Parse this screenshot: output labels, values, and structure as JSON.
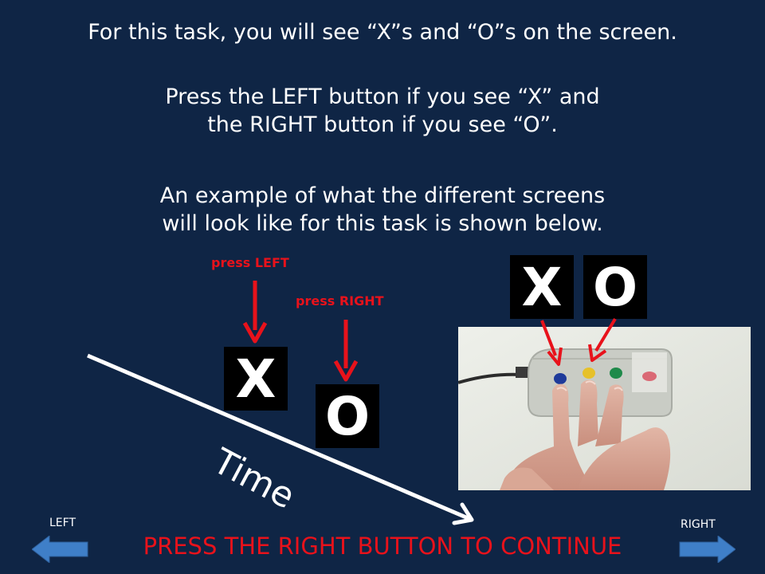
{
  "instructions": {
    "line1": "For this task, you will see “X”s and “O”s on the screen.",
    "line2a": "Press the LEFT button if you see “X” and",
    "line2b": "the RIGHT button if you see “O”.",
    "line3a": "An example of what the different screens",
    "line3b": "will look like for this task is shown below."
  },
  "diagram": {
    "press_left_label": "press LEFT",
    "press_right_label": "press RIGHT",
    "letter_x": "X",
    "letter_o": "O",
    "time_label": "Time"
  },
  "device_example": {
    "letter_x": "X",
    "letter_o": "O",
    "button_colors": [
      "#1e3a9a",
      "#e6c12a",
      "#1f8a4a",
      "#d84a5a"
    ]
  },
  "navigation": {
    "left_label": "LEFT",
    "right_label": "RIGHT",
    "continue_text": "PRESS THE RIGHT BUTTON TO CONTINUE"
  },
  "colors": {
    "background": "#0f2545",
    "accent_red": "#e8121b",
    "nav_arrow_blue": "#3f7fc8"
  }
}
